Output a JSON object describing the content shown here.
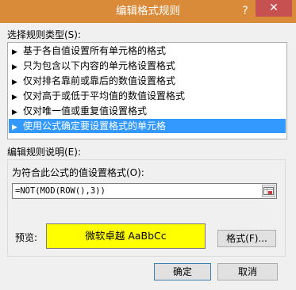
{
  "window": {
    "title": "编辑格式规则",
    "help": "?",
    "close": "✕"
  },
  "rule_type": {
    "label": "选择规则类型(S):",
    "items": [
      {
        "label": "基于各自值设置所有单元格的格式"
      },
      {
        "label": "只为包含以下内容的单元格设置格式"
      },
      {
        "label": "仅对排名靠前或靠后的数值设置格式"
      },
      {
        "label": "仅对高于或低于平均值的数值设置格式"
      },
      {
        "label": "仅对唯一值或重复值设置格式"
      },
      {
        "label": "使用公式确定要设置格式的单元格",
        "selected": true
      }
    ]
  },
  "rule_desc": {
    "label": "编辑规则说明(E):",
    "formula_label": "为符合此公式的值设置格式(O):",
    "formula_value": "=NOT(MOD(ROW(),3))",
    "preview_label": "预览:",
    "preview_text": "微软卓越  AaBbCc",
    "preview_color": "#ffff00",
    "format_button": "格式(F)..."
  },
  "buttons": {
    "ok": "确定",
    "cancel": "取消"
  },
  "colors": {
    "titlebar": "#d98b3a",
    "selection": "#3399ff",
    "close": "#c75050"
  }
}
